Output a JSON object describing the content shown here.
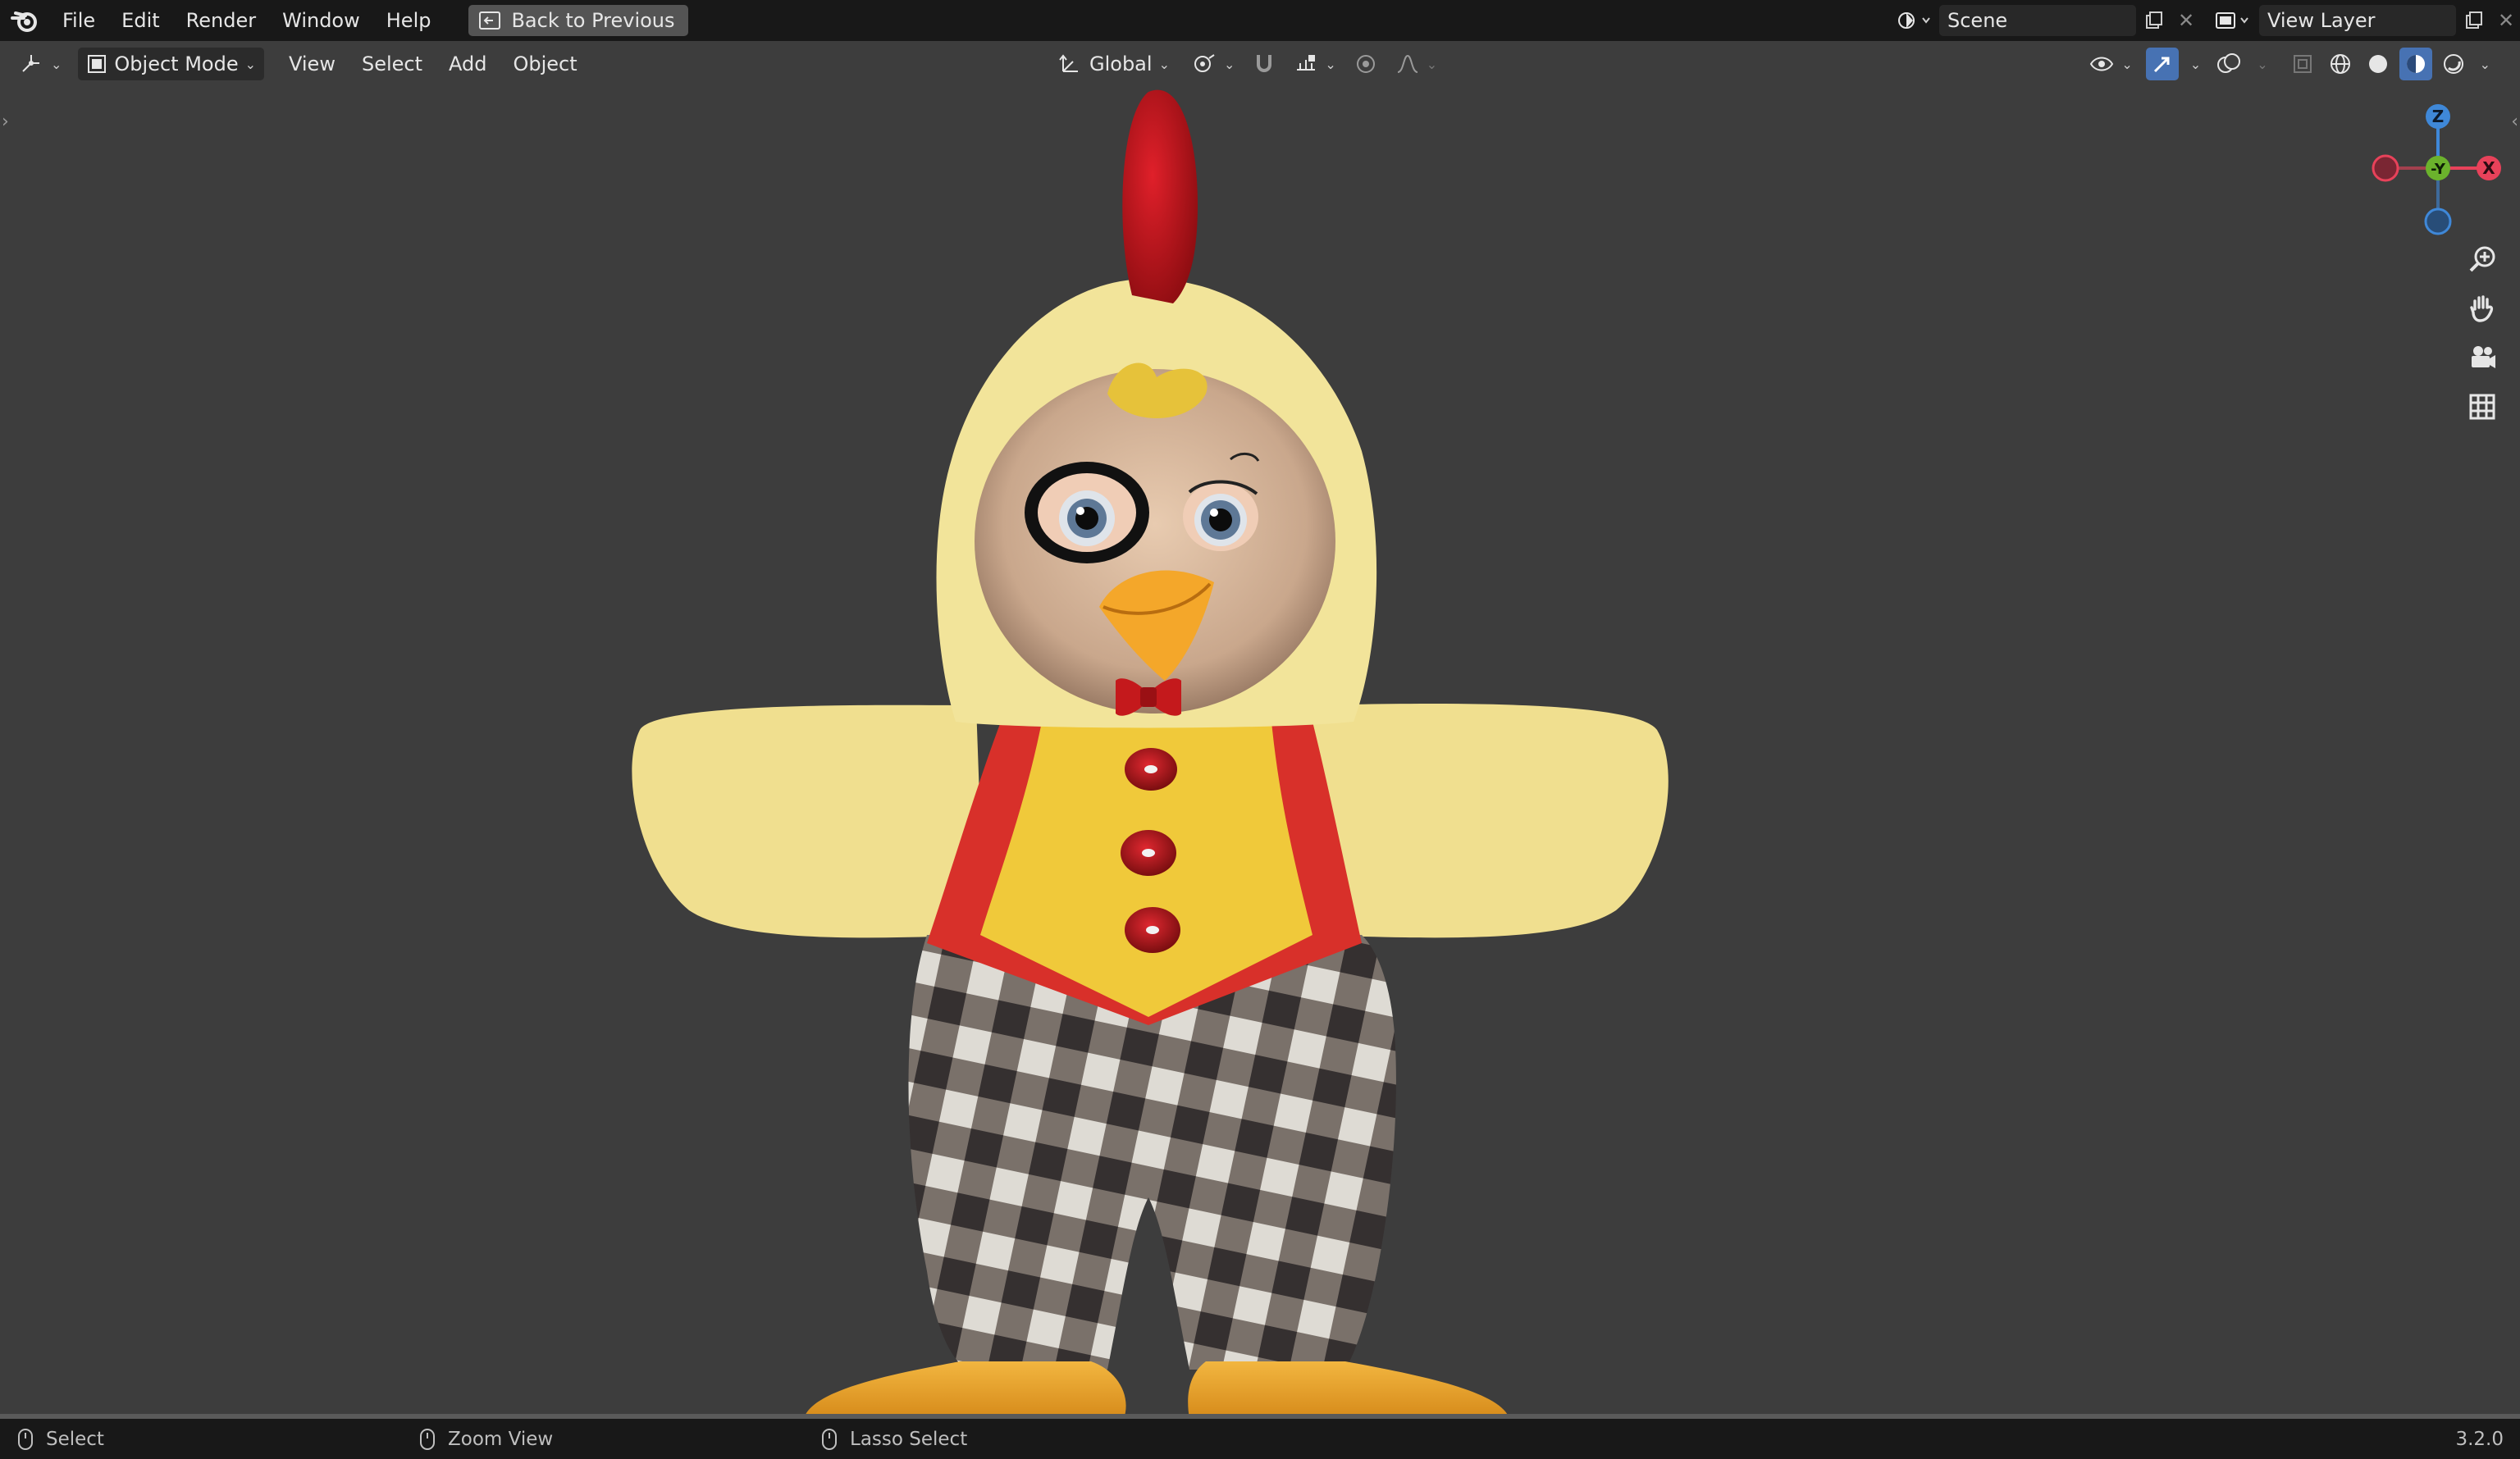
{
  "topbar": {
    "menus": [
      "File",
      "Edit",
      "Render",
      "Window",
      "Help"
    ],
    "back_label": "Back to Previous",
    "scene_label": "Scene",
    "view_layer_label": "View Layer"
  },
  "viewport_header": {
    "mode_label": "Object Mode",
    "menus": [
      "View",
      "Select",
      "Add",
      "Object"
    ],
    "orientation_label": "Global"
  },
  "gizmo": {
    "z_label": "Z",
    "y_label": "-Y",
    "x_label": "X"
  },
  "statusbar": {
    "left_label": "Select",
    "middle_label": "Zoom View",
    "right_label": "Lasso Select",
    "version": "3.2.0"
  },
  "colors": {
    "accent": "#4772b3",
    "x_axis": "#e8425a",
    "y_axis": "#6bb22c",
    "z_axis": "#3f88d8"
  },
  "icons": {
    "app": "blender-logo-icon",
    "zoom": "zoom-icon",
    "pan": "hand-icon",
    "camera": "camera-icon",
    "grid": "grid-icon"
  }
}
